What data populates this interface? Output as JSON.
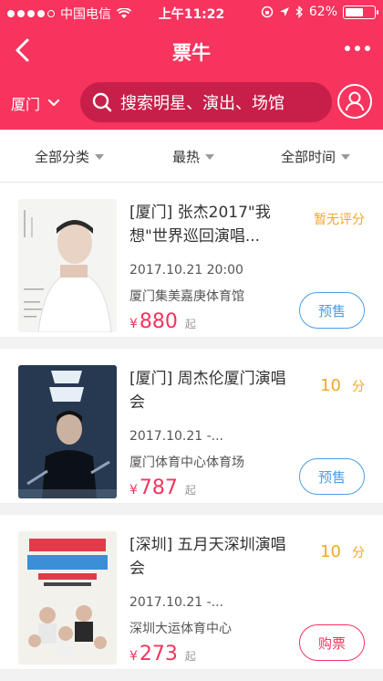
{
  "status_bar": {
    "carrier": "中国电信",
    "time": "上午11:22",
    "battery_label": "62%",
    "battery_level": 0.62,
    "signal_dots_filled": 4,
    "signal_dots_total": 5
  },
  "navbar": {
    "title": "票牛",
    "back_icon": "chevron-left-icon",
    "more_icon": "more-dots-icon"
  },
  "search": {
    "city": "厦门",
    "placeholder": "搜索明星、演出、场馆",
    "user_icon": "user-icon"
  },
  "filters": [
    {
      "label": "全部分类"
    },
    {
      "label": "最热"
    },
    {
      "label": "全部时间"
    }
  ],
  "events": [
    {
      "title": "[厦门] 张杰2017\"我想\"世界巡回演唱...",
      "rating_text": "暂无评分",
      "rating_num": "",
      "rating_unit": "",
      "date": "2017.10.21 20:00",
      "venue": "厦门集美嘉庚体育馆",
      "currency": "¥",
      "price": "880",
      "price_suffix": "起",
      "action": "预售",
      "action_type": "presale"
    },
    {
      "title": "[厦门] 周杰伦厦门演唱会",
      "rating_text": "",
      "rating_num": "10",
      "rating_unit": "分",
      "date": "2017.10.21 -...",
      "venue": "厦门体育中心体育场",
      "currency": "¥",
      "price": "787",
      "price_suffix": "起",
      "action": "预售",
      "action_type": "presale"
    },
    {
      "title": "[深圳] 五月天深圳演唱会",
      "rating_text": "",
      "rating_num": "10",
      "rating_unit": "分",
      "date": "2017.10.21 -...",
      "venue": "深圳大运体育中心",
      "currency": "¥",
      "price": "273",
      "price_suffix": "起",
      "action": "购票",
      "action_type": "buy"
    }
  ],
  "colors": {
    "brand": "#f6345e",
    "rating": "#f5a623",
    "presale": "#4a9ee8"
  }
}
